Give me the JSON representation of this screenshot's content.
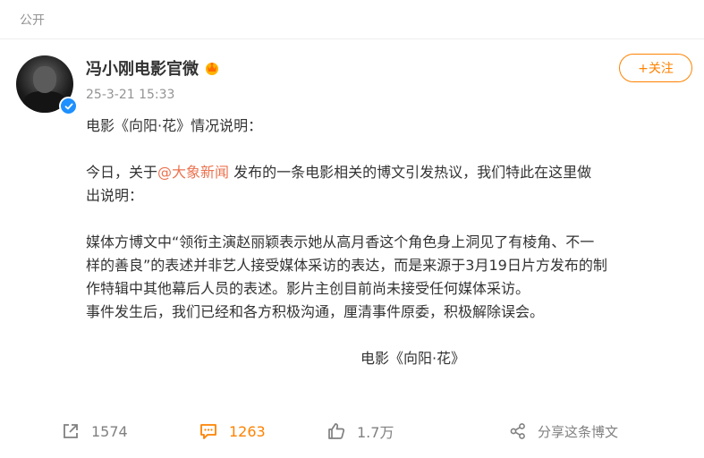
{
  "header": {
    "visibility": "公开"
  },
  "author": {
    "name": "冯小刚电影官微",
    "time": "25-3-21 15:33",
    "verified_color": "#1e90ff"
  },
  "follow": {
    "label": "+关注",
    "accent": "#ff8200"
  },
  "post": {
    "title_line": "电影《向阳·花》情况说明：",
    "p1_before": "今日，关于",
    "p1_mention": "@大象新闻",
    "p1_line1_after": " 发布的一条电影相关的博文引发热议，我们特此在这里做",
    "p1_line2": "出说明：",
    "p2_line1": "媒体方博文中“领衔主演赵丽颖表示她从高月香这个角色身上洞见了有棱角、不一",
    "p2_line2": "样的善良”的表述并非艺人接受媒体采访的表达，而是来源于3月19日片方发布的制",
    "p2_line3": "作特辑中其他幕后人员的表述。影片主创目前尚未接受任何媒体采访。",
    "p3": "事件发生后，我们已经和各方积极沟通，厘清事件原委，积极解除误会。",
    "signature": "电影《向阳·花》"
  },
  "actions": {
    "repost_count": "1574",
    "comment_count": "1263",
    "like_count": "1.7万",
    "share_label": "分享这条博文"
  }
}
